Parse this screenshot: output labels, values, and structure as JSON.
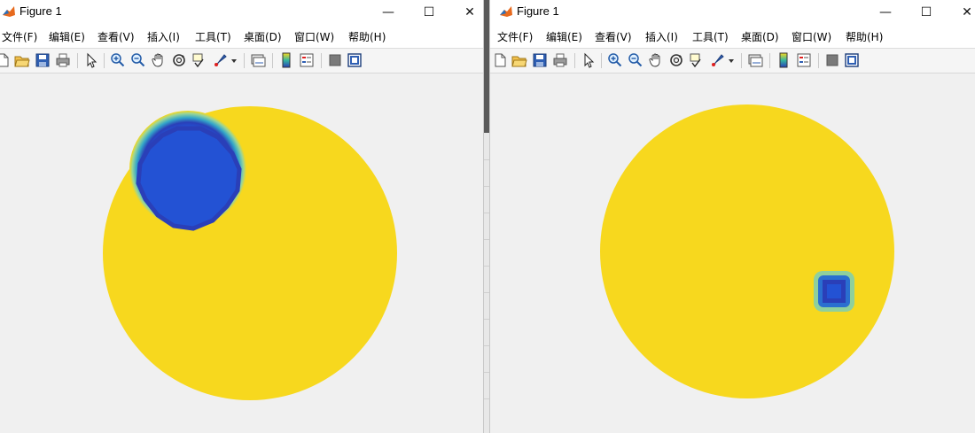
{
  "windows": [
    {
      "title": "Figure 1",
      "controls": {
        "minimize": "—",
        "maximize": "☐",
        "close": "✕"
      },
      "menu": [
        "文件(F)",
        "编辑(E)",
        "查看(V)",
        "插入(I)",
        "工具(T)",
        "桌面(D)",
        "窗口(W)",
        "帮助(H)"
      ]
    },
    {
      "title": "Figure 1",
      "controls": {
        "minimize": "—",
        "maximize": "☐",
        "close": "✕"
      },
      "menu": [
        "文件(F)",
        "编辑(E)",
        "查看(V)",
        "插入(I)",
        "工具(T)",
        "桌面(D)",
        "窗口(W)",
        "帮助(H)"
      ]
    }
  ],
  "toolbar_icons": [
    "new-figure-icon",
    "open-file-icon",
    "save-icon",
    "print-icon",
    "edit-plot-arrow-icon",
    "zoom-in-icon",
    "zoom-out-icon",
    "pan-hand-icon",
    "rotate-3d-icon",
    "data-cursor-icon",
    "brush-icon",
    "brush-dropdown-icon",
    "link-plot-icon",
    "insert-colorbar-icon",
    "insert-legend-icon",
    "hide-plot-tools-icon",
    "show-plot-tools-icon"
  ],
  "colors": {
    "disk": "#f7d81e",
    "background": "#f0f0f0",
    "inclusion_core": "#2352d4",
    "inclusion_ring": "#2a3fb8",
    "halo_outer": "#7fc9b6"
  }
}
